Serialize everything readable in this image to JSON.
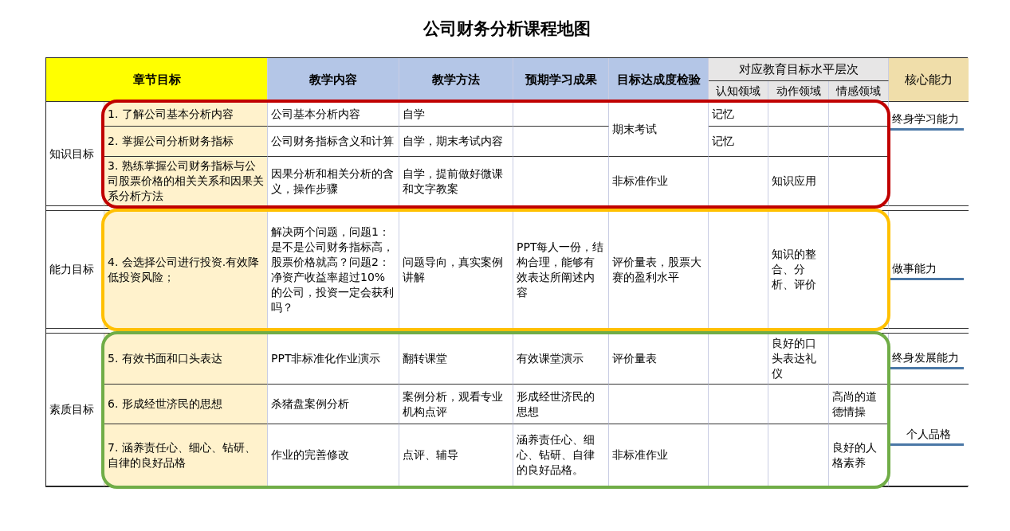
{
  "title": "公司财务分析课程地图",
  "header": {
    "goal": "章节目标",
    "content": "教学内容",
    "method": "教学方法",
    "outcome": "预期学习成果",
    "assessment": "目标达成度检验",
    "levels_group": "对应教育目标水平层次",
    "levels": [
      "认知领域",
      "动作领域",
      "情感领域"
    ],
    "core": "核心能力"
  },
  "groups": [
    {
      "category": "知识目标",
      "color": "#c00000",
      "segments": [
        {
          "core": "终身学习能力",
          "parts": [
            {
              "assessment": "期末考试",
              "rows": [
                {
                  "goal": "1. 了解公司基本分析内容",
                  "content": "公司基本分析内容",
                  "method": "自学",
                  "cognitive": "记忆"
                },
                {
                  "goal": "2. 掌握公司分析财务指标",
                  "content": "公司财务指标含义和计算",
                  "method": "自学，期末考试内容",
                  "cognitive": "记忆"
                }
              ]
            },
            {
              "assessment": "非标准作业",
              "rows": [
                {
                  "goal": "3. 熟练掌握公司财务指标与公司股票价格的相关关系和因果关系分析方法",
                  "content": "因果分析和相关分析的含义，操作步骤",
                  "method": "自学，提前做好微课和文字教案",
                  "psychomotor": "知识应用"
                }
              ]
            }
          ]
        }
      ]
    },
    {
      "category": "能力目标",
      "color": "#ffc000",
      "segments": [
        {
          "core": "做事能力",
          "parts": [
            {
              "assessment": "评价量表，股票大赛的盈利水平",
              "rows": [
                {
                  "goal": "4. 会选择公司进行投资.有效降低投资风险；",
                  "content": "解决两个问题，问题1：是不是公司财务指标高，股票价格就高？问题2：净资产收益率超过10%的公司，投资一定会获利吗？",
                  "method": "问题导向，真实案例讲解",
                  "outcome": "PPT每人一份，结构合理，能够有效表达所阐述内容",
                  "psychomotor": "知识的整合、分析、评价"
                }
              ]
            }
          ]
        }
      ]
    },
    {
      "category": "素质目标",
      "color": "#70ad47",
      "segments": [
        {
          "core": "终身发展能力",
          "parts": [
            {
              "assessment": "评价量表",
              "rows": [
                {
                  "goal": "5. 有效书面和口头表达",
                  "content": "PPT非标准化作业演示",
                  "method": "翻转课堂",
                  "outcome": "有效课堂演示",
                  "psychomotor": "良好的口头表达礼仪"
                }
              ]
            }
          ]
        },
        {
          "core": "个人品格",
          "parts": [
            {
              "rows": [
                {
                  "goal": "6. 形成经世济民的思想",
                  "content": "杀猪盘案例分析",
                  "method": "案例分析，观看专业机构点评",
                  "outcome": "形成经世济民的思想",
                  "affective": "高尚的道德情操"
                }
              ]
            },
            {
              "assessment": "非标准作业",
              "rows": [
                {
                  "goal": "7. 涵养责任心、细心、钻研、自律的良好品格",
                  "content": "作业的完善修改",
                  "method": "点评、辅导",
                  "outcome": "涵养责任心、细心、钻研、自律的良好品格。",
                  "affective": "良好的人格素养"
                }
              ]
            }
          ]
        }
      ]
    }
  ]
}
